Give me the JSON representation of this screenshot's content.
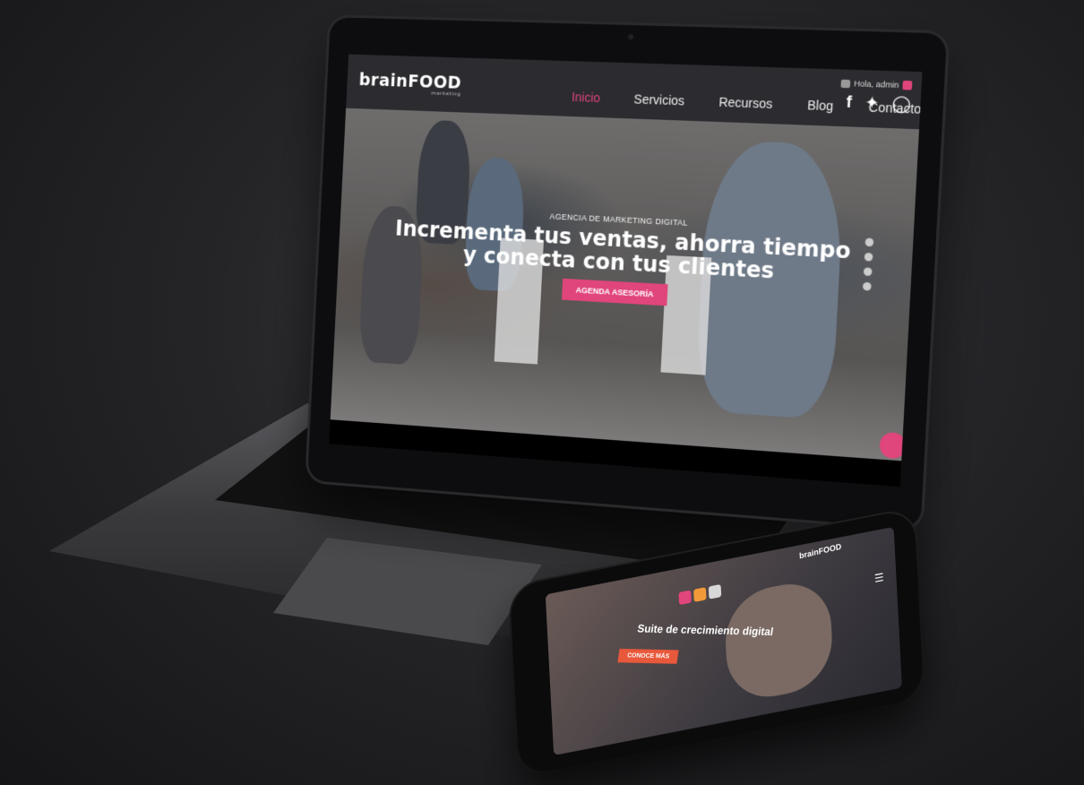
{
  "site": {
    "logo": "brainFOOD",
    "logo_sub": "marketing",
    "nav": [
      {
        "label": "Inicio",
        "active": true
      },
      {
        "label": "Servicios",
        "active": false
      },
      {
        "label": "Recursos",
        "active": false
      },
      {
        "label": "Blog",
        "active": false
      },
      {
        "label": "Contacto",
        "active": false
      }
    ],
    "greeting": "Hola, admin",
    "social_icons": [
      "facebook-icon",
      "twitter-icon",
      "instagram-icon"
    ],
    "hero": {
      "eyebrow": "AGENCIA DE MARKETING DIGITAL",
      "headline_line1": "Incrementa tus ventas, ahorra tiempo",
      "headline_line2": "y conecta con tus clientes",
      "cta": "AGENDA ASESORÍA"
    },
    "slider_dots": 4,
    "accent_color": "#e0457b"
  },
  "mobile": {
    "logo": "brainFOOD",
    "title": "Suite de crecimiento digital",
    "cta": "CONOCE MÁS",
    "cta_color": "#e8583b"
  }
}
